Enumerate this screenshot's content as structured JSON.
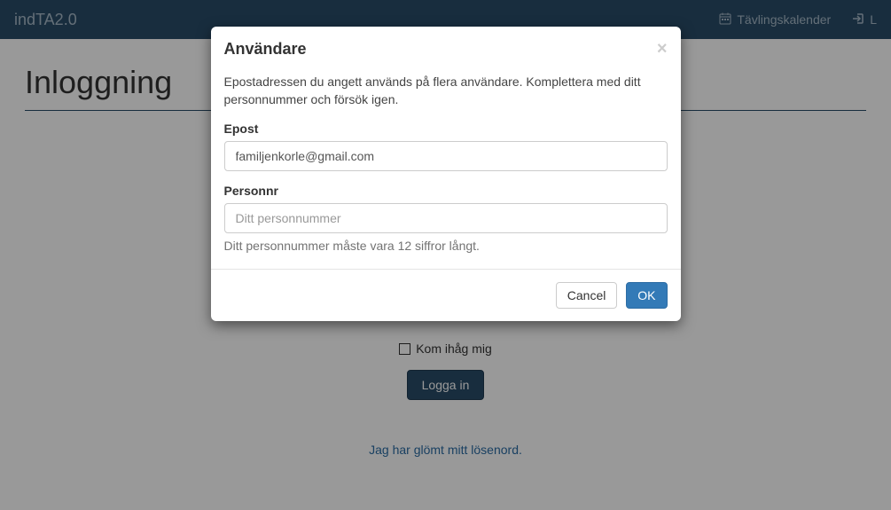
{
  "navbar": {
    "brand": "indTA2.0",
    "calendar": "Tävlingskalender",
    "login_partial": "L"
  },
  "page": {
    "heading": "Inloggning",
    "remember_label": "Kom ihåg mig",
    "login_button": "Logga in",
    "forgot_link": "Jag har glömt mitt lösenord."
  },
  "modal": {
    "title": "Användare",
    "message": "Epostadressen du angett används på flera användare. Komplettera med ditt personnummer och försök igen.",
    "email_label": "Epost",
    "email_value": "familjenkorle@gmail.com",
    "pn_label": "Personnr",
    "pn_placeholder": "Ditt personnummer",
    "pn_help": "Ditt personnummer måste vara 12 siffror långt.",
    "cancel": "Cancel",
    "ok": "OK"
  }
}
